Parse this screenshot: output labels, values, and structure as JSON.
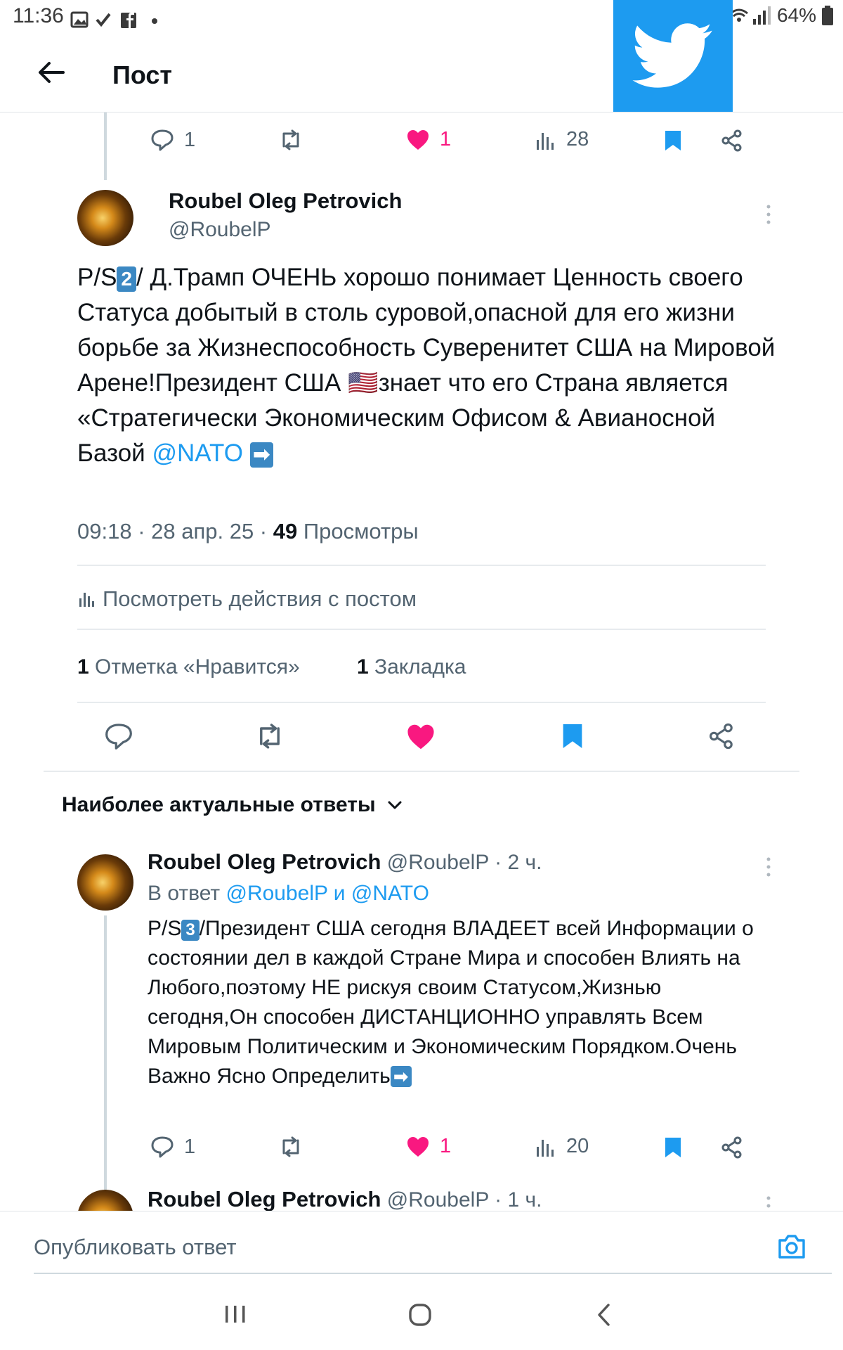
{
  "status_bar": {
    "time": "11:36",
    "battery": "64%"
  },
  "header": {
    "title": "Пост"
  },
  "colors": {
    "accent": "#1d9bf0",
    "like": "#f91880",
    "muted": "#536471"
  },
  "prev_post_actions": {
    "replies": "1",
    "likes": "1",
    "views": "28"
  },
  "main_post": {
    "author_name": "Roubel Oleg Petrovich",
    "author_handle": "@RoubelP",
    "text_part1": "P/S",
    "keycap": "2",
    "text_part2": "/ Д.Трамп ОЧЕНЬ хорошо понимает Ценность своего Статуса добытый в столь суровой,опасной для его жизни борьбе за Жизнеспособность Суверенитет США на Мировой Арене!Президент США ",
    "flag": "🇺🇸",
    "text_part3": "знает что  его Страна является «Стратегически Экономическим Офисом & Авианосной Базой ",
    "mention": "@NATO",
    "arrow": "➡",
    "timestamp": "09:18 · 28 апр. 25 · ",
    "views_count": "49",
    "views_label": " Просмотры",
    "activity_link": "Посмотреть действия с постом",
    "likes_count": "1",
    "likes_label": " Отметка «Нравится»",
    "bookmarks_count": "1",
    "bookmarks_label": " Закладка"
  },
  "replies_section": {
    "sort_label": "Наиболее актуальные ответы"
  },
  "reply1": {
    "author_name": "Roubel Oleg Petrovich",
    "author_handle": "@RoubelP",
    "time": " · 2 ч.",
    "in_reply_prefix": "В ответ ",
    "in_reply_to": "@RoubelP и @NATO",
    "text_part1": "P/S",
    "keycap": "3",
    "text_part2": "/Президент США сегодня ВЛАДЕЕТ всей Информации о состоянии дел в каждой Стране Мира и способен Влиять на Любого,поэтому НЕ рискуя своим Статусом,Жизнью сегодня,Он способен ДИСТАНЦИОННО управлять Всем Мировым Политическим и Экономическим Порядком.Очень Важно Ясно Определить",
    "arrow": "➡",
    "replies": "1",
    "likes": "1",
    "views": "20"
  },
  "reply2": {
    "author_name": "Roubel Oleg Petrovich",
    "author_handle": "@RoubelP",
    "time": " · 1 ч."
  },
  "composer": {
    "placeholder": "Опубликовать ответ"
  }
}
